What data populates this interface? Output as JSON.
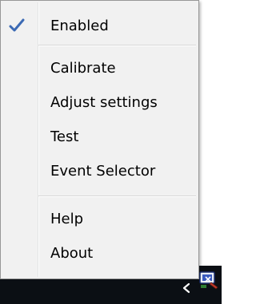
{
  "menu": {
    "items": [
      {
        "label": "Enabled",
        "checked": true
      },
      {
        "label": "Calibrate"
      },
      {
        "label": "Adjust settings"
      },
      {
        "label": "Test"
      },
      {
        "label": "Event Selector"
      },
      {
        "label": "Help"
      },
      {
        "label": "About"
      }
    ]
  },
  "taskbar": {
    "tray_chevron_icon": "chevron-left-icon",
    "tray_app_icon": "wacom-tablet-icon"
  },
  "colors": {
    "menu_bg": "#f1f1f1",
    "menu_border": "#979797",
    "check": "#3c6ab4",
    "taskbar_bg": "#0b0f14"
  }
}
